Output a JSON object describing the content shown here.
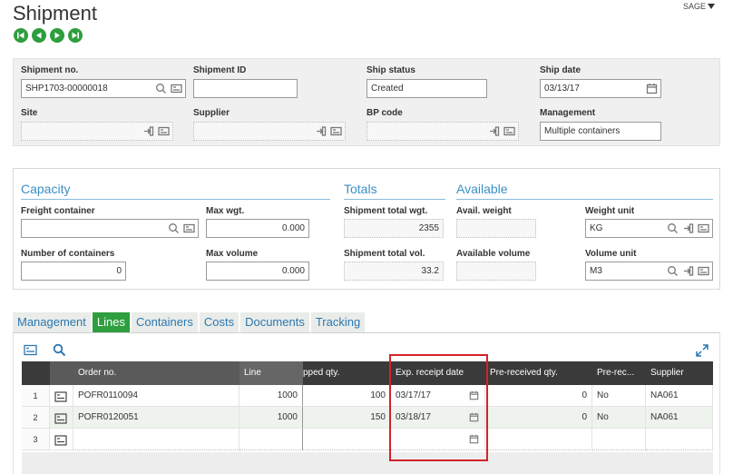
{
  "page": {
    "title": "Shipment",
    "sage_menu": "SAGE"
  },
  "nav": [
    "first-record",
    "previous-record",
    "next-record",
    "last-record"
  ],
  "header": {
    "shipment_no": {
      "label": "Shipment no.",
      "value": "SHP1703-00000018"
    },
    "shipment_id": {
      "label": "Shipment ID",
      "value": ""
    },
    "ship_status": {
      "label": "Ship status",
      "value": "Created"
    },
    "ship_date": {
      "label": "Ship date",
      "value": "03/13/17"
    },
    "site": {
      "label": "Site",
      "value": ""
    },
    "supplier": {
      "label": "Supplier",
      "value": ""
    },
    "bp_code": {
      "label": "BP code",
      "value": ""
    },
    "management": {
      "label": "Management",
      "value": "Multiple containers"
    }
  },
  "capacity": {
    "title": "Capacity",
    "freight_container": {
      "label": "Freight container",
      "value": ""
    },
    "max_wgt": {
      "label": "Max wgt.",
      "value": "0.000"
    },
    "number_of_containers": {
      "label": "Number of containers",
      "value": "0"
    },
    "max_volume": {
      "label": "Max volume",
      "value": "0.000"
    }
  },
  "totals": {
    "title": "Totals",
    "total_wgt": {
      "label": "Shipment total wgt.",
      "value": "2355"
    },
    "total_vol": {
      "label": "Shipment total vol.",
      "value": "33.2"
    }
  },
  "available": {
    "title": "Available",
    "avail_weight": {
      "label": "Avail. weight",
      "value": ""
    },
    "available_volume": {
      "label": "Available volume",
      "value": ""
    },
    "weight_unit": {
      "label": "Weight unit",
      "value": "KG"
    },
    "volume_unit": {
      "label": "Volume unit",
      "value": "M3"
    }
  },
  "tabs": [
    "Management",
    "Lines",
    "Containers",
    "Costs",
    "Documents",
    "Tracking"
  ],
  "active_tab": "Lines",
  "grid": {
    "columns": [
      "Order no.",
      "Line",
      "pped qty.",
      "Exp. receipt date",
      "Pre-received qty.",
      "Pre-rec...",
      "Supplier"
    ],
    "rows": [
      {
        "n": "1",
        "order_no": "POFR0110094",
        "line": "1000",
        "qty": "100",
        "exp_date": "03/17/17",
        "pre_qty": "0",
        "pre_rec": "No",
        "supplier": "NA061"
      },
      {
        "n": "2",
        "order_no": "POFR0120051",
        "line": "1000",
        "qty": "150",
        "exp_date": "03/18/17",
        "pre_qty": "0",
        "pre_rec": "No",
        "supplier": "NA061"
      },
      {
        "n": "3",
        "order_no": "",
        "line": "",
        "qty": "",
        "exp_date": "",
        "pre_qty": "",
        "pre_rec": "",
        "supplier": ""
      }
    ]
  },
  "colors": {
    "accent_green": "#2e9e3e",
    "section_blue": "#3b8fc4",
    "highlight_red": "#d2232a"
  }
}
